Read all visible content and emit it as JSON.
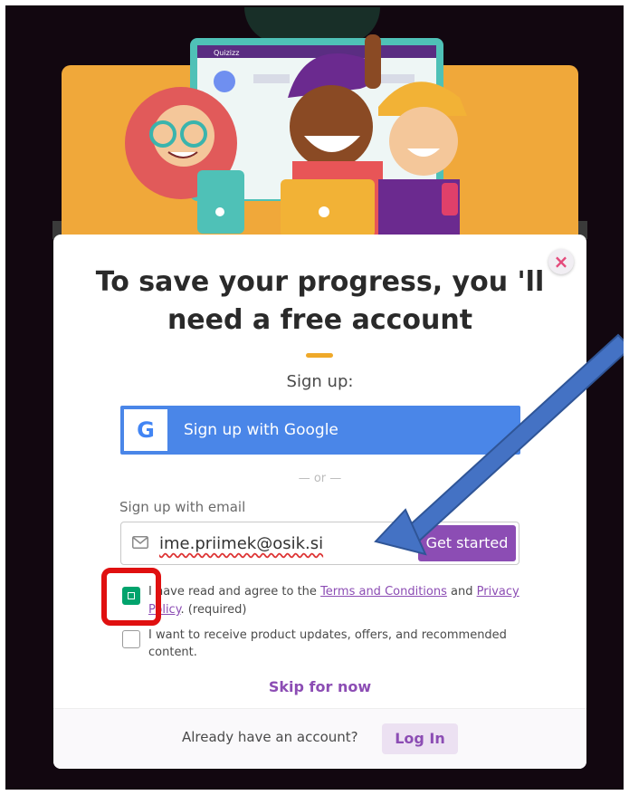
{
  "modal": {
    "title": "To save your progress, you 'll need a free account",
    "close_glyph": "×",
    "signup_label": "Sign up:",
    "google_logo_letter": "G",
    "google_button_label": "Sign up with Google",
    "or_separator": "— or —",
    "email_section_label": "Sign up with email",
    "email_value": "ime.priimek@osik.si",
    "get_started_label": "Get started",
    "terms": {
      "prefix": "I have read and agree to the ",
      "terms_link": "Terms and Conditions",
      "middle": " and ",
      "privacy_link": "Privacy Policy",
      "suffix": ". (required)",
      "checked": true
    },
    "updates": {
      "label": "I want to receive product updates, offers, and recommended content.",
      "checked": false
    },
    "skip_label": "Skip for now",
    "footer": {
      "already_text": "Already have an account?",
      "login_label": "Log In"
    }
  },
  "illustration": {
    "brand_text": "Quizizz"
  },
  "colors": {
    "accent_purple": "#8c4db4",
    "google_blue": "#4a86e8",
    "banner_orange": "#f0a83a",
    "checkbox_green": "#00a36c",
    "highlight_red": "#e01010",
    "arrow_blue": "#4472c4"
  }
}
